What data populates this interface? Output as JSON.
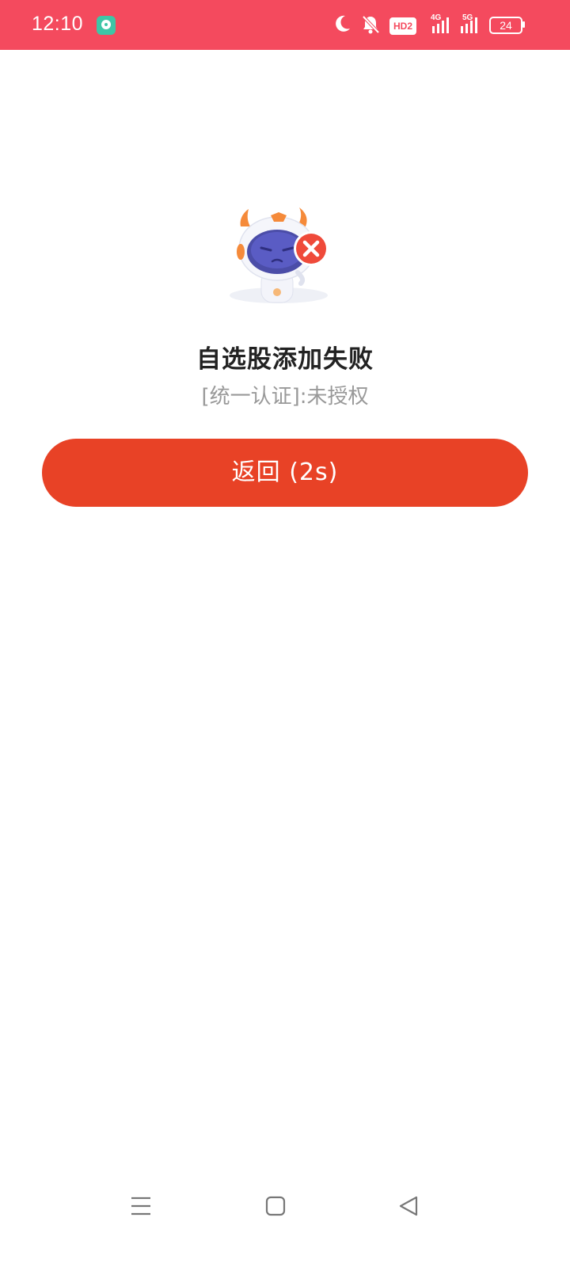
{
  "status_bar": {
    "time": "12:10",
    "network_4g": "4G",
    "network_5g": "5G",
    "hd_label": "HD2",
    "battery": "24",
    "colors": {
      "background": "#f44a5e",
      "notification_app": "#3ec6a6"
    },
    "icons": [
      "notification-app-icon",
      "moon-icon",
      "bell-muted-icon",
      "hd-voice-icon",
      "signal-4g-icon",
      "signal-5g-icon",
      "battery-icon"
    ]
  },
  "main": {
    "illustration": "mascot-error-illustration",
    "title": "自选股添加失败",
    "message": "[统一认证]:未授权",
    "back_button_label": "返回 (2s)",
    "colors": {
      "button": "#e84226",
      "title": "#222222",
      "message": "#999999"
    }
  },
  "nav_bar": {
    "icons": [
      "menu-icon",
      "home-icon",
      "back-icon"
    ]
  }
}
